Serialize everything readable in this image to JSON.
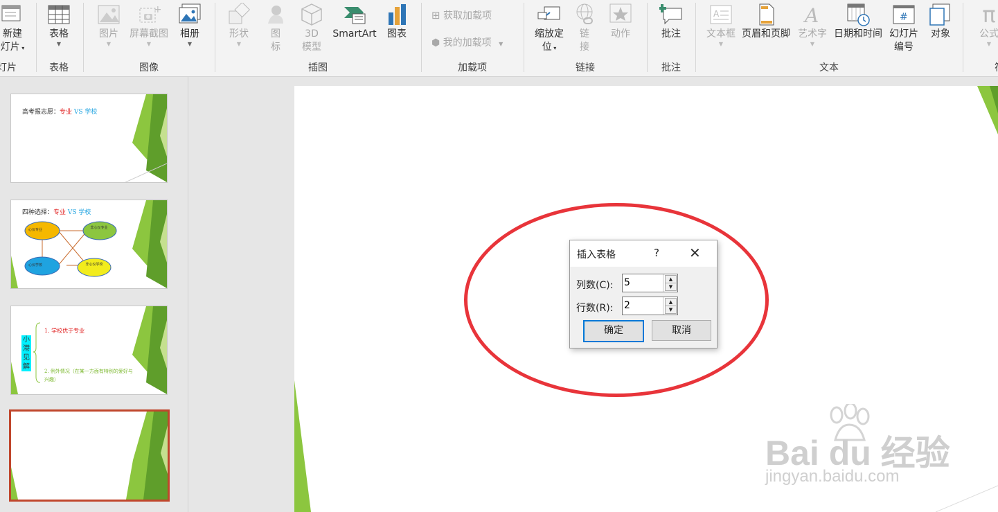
{
  "ribbon": {
    "groups": [
      {
        "label": "灯片"
      },
      {
        "label": "表格"
      },
      {
        "label": "图像"
      },
      {
        "label": "插图"
      },
      {
        "label": "加载项"
      },
      {
        "label": "链接"
      },
      {
        "label": "批注"
      },
      {
        "label": "文本"
      },
      {
        "label": "符"
      }
    ],
    "new_slide": {
      "line1": "新建",
      "line2": "灯片"
    },
    "table": "表格",
    "pictures": "图片",
    "screenshot": "屏幕截图",
    "album": "相册",
    "shapes": "形状",
    "icons": {
      "line1": "图",
      "line2": "标"
    },
    "models3d": {
      "line1": "3D",
      "line2": "模型"
    },
    "smartart": "SmartArt",
    "chart": "图表",
    "get_addins": "获取加载项",
    "my_addins": "我的加载项",
    "zoom": {
      "line1": "缩放定",
      "line2": "位"
    },
    "link": {
      "line1": "链",
      "line2": "接"
    },
    "action": "动作",
    "comment": "批注",
    "textbox": "文本框",
    "header_footer": "页眉和页脚",
    "wordart": "艺术字",
    "datetime": "日期和时间",
    "slide_number": {
      "line1": "幻灯片",
      "line2": "编号"
    },
    "object": "对象",
    "formula": "公式"
  },
  "slides": {
    "slide1": {
      "title_prefix": "高考报志愿：",
      "red": "专业",
      "vs": " VS ",
      "blue": "学校"
    },
    "slide2": {
      "title_prefix": "四种选择：",
      "red": "专业",
      "vs": " VS ",
      "blue": "学校",
      "nodes": [
        "心仪专业",
        "非心仪专业",
        "心仪学校",
        "非心仪学校"
      ]
    },
    "slide3": {
      "side_label": "小港见解",
      "point1": "1. 学校优于专业",
      "point2": "2. 例外情况（在某一方面有特别的爱好与兴趣）"
    }
  },
  "dialog": {
    "title": "插入表格",
    "help": "?",
    "close": "✕",
    "columns_label": "列数(C):",
    "columns_value": "5",
    "rows_label": "行数(R):",
    "rows_value": "2",
    "ok": "确定",
    "cancel": "取消"
  },
  "watermark": {
    "brand": "Bai du 经验",
    "url": "jingyan.baidu.com"
  },
  "colors": {
    "accent_red": "#e8343a",
    "selected_border": "#c0462c",
    "green": "#7cb82f"
  }
}
